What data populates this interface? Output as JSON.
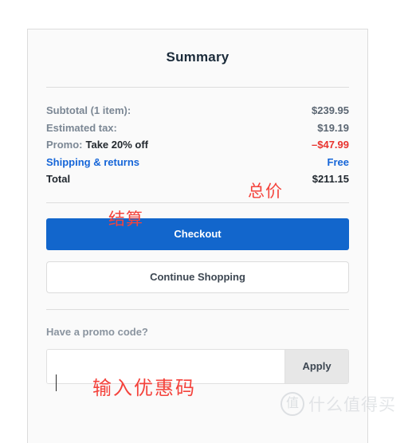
{
  "card": {
    "title": "Summary",
    "accent_blue": "#1266cc",
    "link_blue": "#1565d8",
    "discount_red": "#e8332e",
    "annotation_red": "#f4433c",
    "card_background": "#fafafa"
  },
  "line_items": [
    {
      "label": "Subtotal (1 item):",
      "extra": "",
      "value": "$239.95"
    },
    {
      "label": "Estimated tax:",
      "extra": "",
      "value": "$19.19"
    },
    {
      "label": "Promo:",
      "extra": "Take 20% off",
      "value": "–$47.99"
    },
    {
      "label": "Shipping & returns",
      "extra": "",
      "value": "Free"
    },
    {
      "label": "Total",
      "extra": "",
      "value": "$211.15"
    }
  ],
  "actions": {
    "checkout_label": "Checkout",
    "continue_shopping_label": "Continue Shopping"
  },
  "promo": {
    "prompt": "Have a promo code?",
    "input_value": "",
    "input_placeholder": "",
    "apply_label": "Apply"
  },
  "annotations": {
    "total": "总价",
    "checkout": "结算",
    "promo_input": "输入优惠码"
  },
  "watermark": {
    "logo_glyph": "值",
    "text": "什么值得买"
  }
}
